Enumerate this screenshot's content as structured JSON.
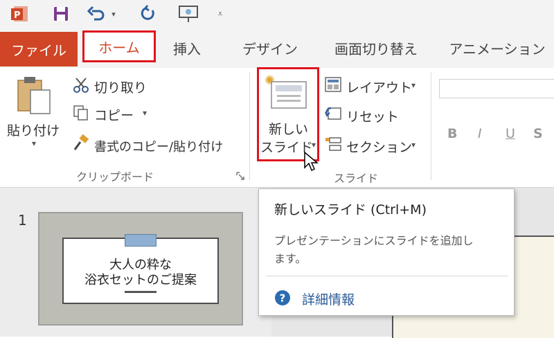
{
  "tabs": {
    "file": "ファイル",
    "home": "ホーム",
    "insert": "挿入",
    "design": "デザイン",
    "transitions": "画面切り替え",
    "animations": "アニメーション"
  },
  "clipboard": {
    "paste": "貼り付け",
    "cut": "切り取り",
    "copy": "コピー",
    "format_painter": "書式のコピー/貼り付け",
    "group_label": "クリップボード"
  },
  "slides": {
    "new_slide_line1": "新しい",
    "new_slide_line2": "スライド",
    "layout": "レイアウト",
    "reset": "リセット",
    "section": "セクション",
    "group_label": "スライド"
  },
  "font": {
    "bold": "B",
    "italic": "I",
    "underline": "U",
    "strike": "S"
  },
  "thumbnail": {
    "number": "1",
    "title_line1": "大人の粋な",
    "title_line2": "浴衣セットのご提案"
  },
  "tooltip": {
    "title": "新しいスライド (Ctrl+M)",
    "description_line1": "プレゼンテーションにスライドを追加し",
    "description_line2": "ます。",
    "link": "詳細情報"
  },
  "colors": {
    "accent": "#d04525",
    "highlight_box": "#e0141e",
    "help_icon": "#2b6cb0"
  },
  "icons": [
    "powerpoint-icon",
    "save-icon",
    "undo-icon",
    "redo-icon",
    "present-icon",
    "customize-icon",
    "paste-icon",
    "scissors-icon",
    "copy-icon",
    "format-painter-icon",
    "new-slide-icon",
    "layout-icon",
    "reset-icon",
    "section-icon",
    "dialog-launcher-icon",
    "help-icon"
  ]
}
